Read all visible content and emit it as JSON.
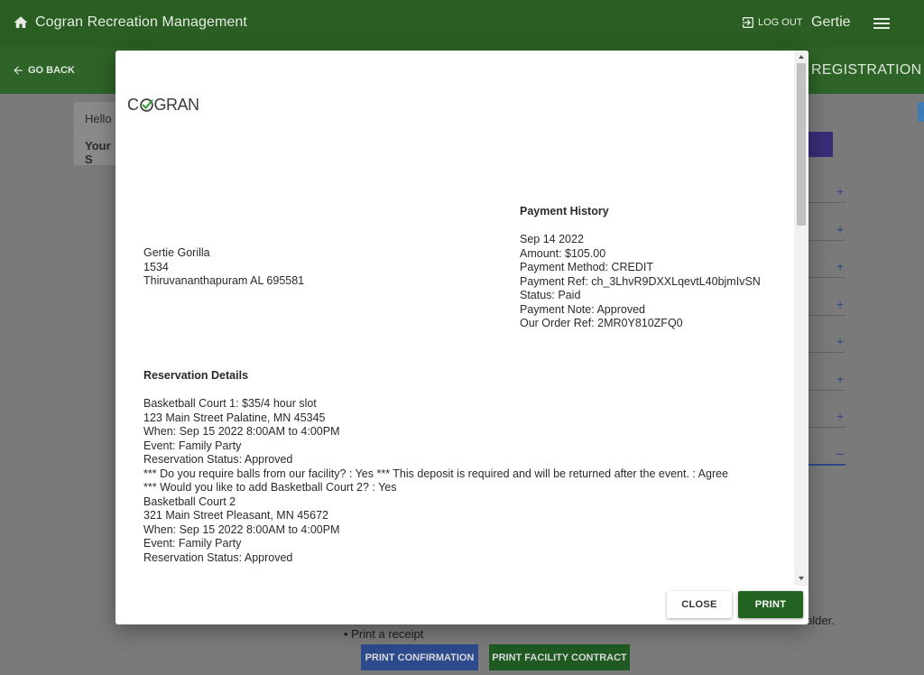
{
  "app": {
    "title": "Cogran Recreation Management",
    "logout_label": "LOG OUT",
    "user_name": "Gertie",
    "go_back_label": "GO BACK",
    "page_heading": "REGISTRATION",
    "card_hello": "Hello",
    "card_yours": "Your S",
    "bullet_text": "•  Print a receipt",
    "folder_text": "older.",
    "print_confirmation_label": "PRINT CONFIRMATION",
    "print_facility_contract_label": "PRINT FACILITY CONTRACT",
    "plus_symbol": "+",
    "minus_symbol": "–"
  },
  "modal": {
    "logo": {
      "before": "C",
      "after": "GRAN"
    },
    "address": {
      "name": "Gertie Gorilla",
      "line1": "1534",
      "line2": "Thiruvananthapuram AL 695581"
    },
    "payment_history": {
      "heading": "Payment History",
      "date": "Sep 14 2022",
      "amount": "Amount: $105.00",
      "method": "Payment Method: CREDIT",
      "ref": "Payment Ref: ch_3LhvR9DXXLqevtL40bjmIvSN",
      "status": "Status: Paid",
      "note": "Payment Note: Approved",
      "order_ref": "Our Order Ref: 2MR0Y810ZFQ0"
    },
    "reservation": {
      "heading": "Reservation Details",
      "lines": [
        "Basketball Court 1: $35/4 hour slot",
        "123 Main Street Palatine, MN 45345",
        "When: Sep 15 2022 8:00AM to 4:00PM",
        "Event: Family Party",
        "Reservation Status: Approved",
        "*** Do you require balls from our facility? : Yes *** This deposit is required and will be returned after the event. : Agree",
        "*** Would you like to add Basketball Court 2? : Yes",
        "Basketball Court 2",
        "321 Main Street Pleasant, MN 45672",
        "When: Sep 15 2022 8:00AM to 4:00PM",
        "Event: Family Party",
        "Reservation Status: Approved"
      ]
    },
    "close_label": "CLOSE",
    "print_label": "PRINT"
  },
  "colors": {
    "header_green": "#2a5e22",
    "print_green": "#226321",
    "overlay": "#7a7a7a"
  }
}
